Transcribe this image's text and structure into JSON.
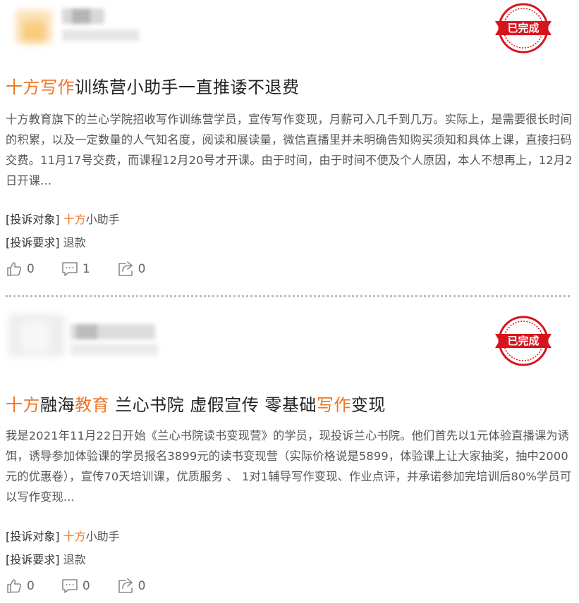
{
  "posts": [
    {
      "status_stamp": "已完成",
      "title_parts": [
        {
          "text": "十方写作",
          "highlight": true
        },
        {
          "text": "训练营小助手一直推诿不退费",
          "highlight": false
        }
      ],
      "description": "十方教育旗下的兰心学院招收写作训练营学员，宣传写作变现，月薪可入几千到几万。实际上，是需要很长时间的积累，以及一定数量的人气知名度，阅读和展读量，微信直播里并未明确告知购买须知和具体上课，直接扫码交费。11月17号交费，而课程12月20号才开课。由于时间，由于时间不便及个人原因，本人不想再上，12月2日开课...",
      "target_label": "[投诉对象]",
      "target_value": {
        "hl": "十方",
        "rest": "小助手"
      },
      "request_label": "[投诉要求]",
      "request_value": "退款",
      "likes": "0",
      "comments": "1",
      "shares": "0"
    },
    {
      "status_stamp": "已完成",
      "title_parts": [
        {
          "text": "十方",
          "highlight": true
        },
        {
          "text": "融海",
          "highlight": false
        },
        {
          "text": "教育",
          "highlight": true
        },
        {
          "text": " 兰心书院 虚假宣传 零基础",
          "highlight": false
        },
        {
          "text": "写作",
          "highlight": true
        },
        {
          "text": "变现",
          "highlight": false
        }
      ],
      "description": "我是2021年11月22日开始《兰心书院读书变现营》的学员，现投诉兰心书院。他们首先以1元体验直播课为诱饵，诱导参加体验课的学员报名3899元的读书变现营（实际价格说是5899，体验课上让大家抽奖，抽中2000元的优惠卷），宣传70天培训课，优质服务 、 1对1辅导写作变现、作业点评，并承诺参加完培训后80%学员可以写作变现...",
      "target_label": "[投诉对象]",
      "target_value": {
        "hl": "十方",
        "rest": "小助手"
      },
      "request_label": "[投诉要求]",
      "request_value": "退款",
      "likes": "0",
      "comments": "0",
      "shares": "0"
    }
  ],
  "colors": {
    "highlight": "#f07524",
    "stamp_red": "#d7141e",
    "icon_gray": "#8a8a8a"
  },
  "icons": [
    "thumbs-up-icon",
    "comment-icon",
    "share-icon"
  ]
}
